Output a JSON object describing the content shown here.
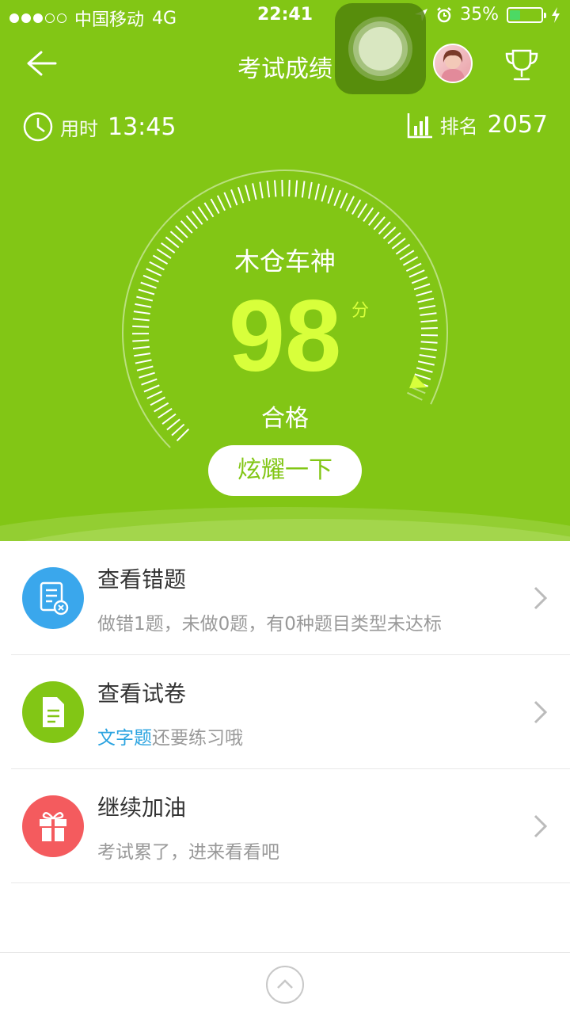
{
  "status_bar": {
    "carrier": "中国移动",
    "network": "4G",
    "time": "22:41",
    "battery": "35%",
    "battery_level": 0.35
  },
  "nav": {
    "title": "考试成绩",
    "back_icon": "arrow-left-icon",
    "trophy_icon": "trophy-icon"
  },
  "stats": {
    "time_label": "用时",
    "time_value": "13:45",
    "rank_label": "排名",
    "rank_value": "2057"
  },
  "gauge": {
    "title": "木仓车神",
    "score": "98",
    "unit": "分",
    "result": "合格",
    "score_fraction": 0.98
  },
  "share_button": "炫耀一下",
  "list": [
    {
      "title": "查看错题",
      "subtitle": "做错1题，未做0题，有0种题目类型未达标",
      "icon": "wrong-questions-icon",
      "color": "#3aa7ec"
    },
    {
      "title": "查看试卷",
      "subtitle_highlight": "文字题",
      "subtitle": "还要练习哦",
      "icon": "document-icon",
      "color": "#82c615"
    },
    {
      "title": "继续加油",
      "subtitle": "考试累了，进来看看吧",
      "icon": "gift-icon",
      "color": "#f45b5e"
    }
  ],
  "colors": {
    "primary": "#82c615",
    "score": "#d8ff3b",
    "highlight": "#2aa3e0"
  }
}
